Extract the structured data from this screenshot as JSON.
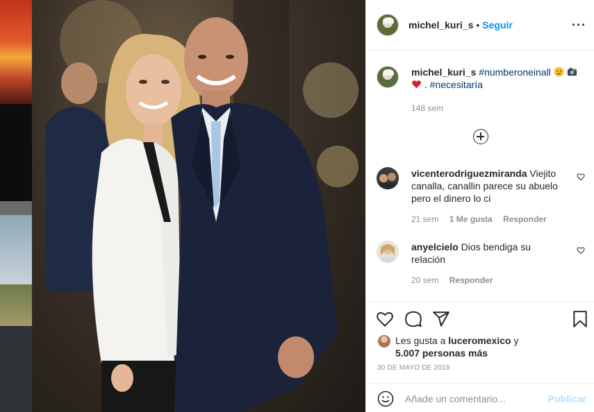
{
  "post": {
    "author": "michel_kuri_s",
    "follow_label": "Seguir",
    "separator": "•",
    "more_label": "···",
    "photo_alt": "Couple photo"
  },
  "caption": {
    "username": "michel_kuri_s",
    "hashtag1": "#numberoneinall",
    "period": ".",
    "hashtag2": "#necesitaría",
    "time": "148 sem"
  },
  "comments": [
    {
      "username": "vicenterodriguezmiranda",
      "text": "Viejito canalla, canallin parece su abuelo pero el dinero lo ci",
      "time": "21 sem",
      "likes": "1 Me gusta",
      "reply": "Responder"
    },
    {
      "username": "anyelcielo",
      "text": "Dios bendiga su relación",
      "time": "20 sem",
      "reply": "Responder"
    }
  ],
  "likes": {
    "prefix": "Les gusta a",
    "user": "luceromexico",
    "conj": "y",
    "others": "5.007 personas más"
  },
  "date": "30 DE MAYO DE 2018",
  "add_comment": {
    "placeholder": "Añade un comentario...",
    "publish": "Publicar"
  },
  "colors": {
    "accent": "#0095f6",
    "link": "#00376b",
    "muted": "#8e8e8e",
    "publish_disabled": "#b2dffc"
  },
  "icons": {
    "like": "heart-icon",
    "comment": "comment-icon",
    "share": "paper-plane-icon",
    "save": "bookmark-icon",
    "emoji": "smiley-icon",
    "more": "more-options-icon",
    "load_more": "plus-circle-icon"
  }
}
